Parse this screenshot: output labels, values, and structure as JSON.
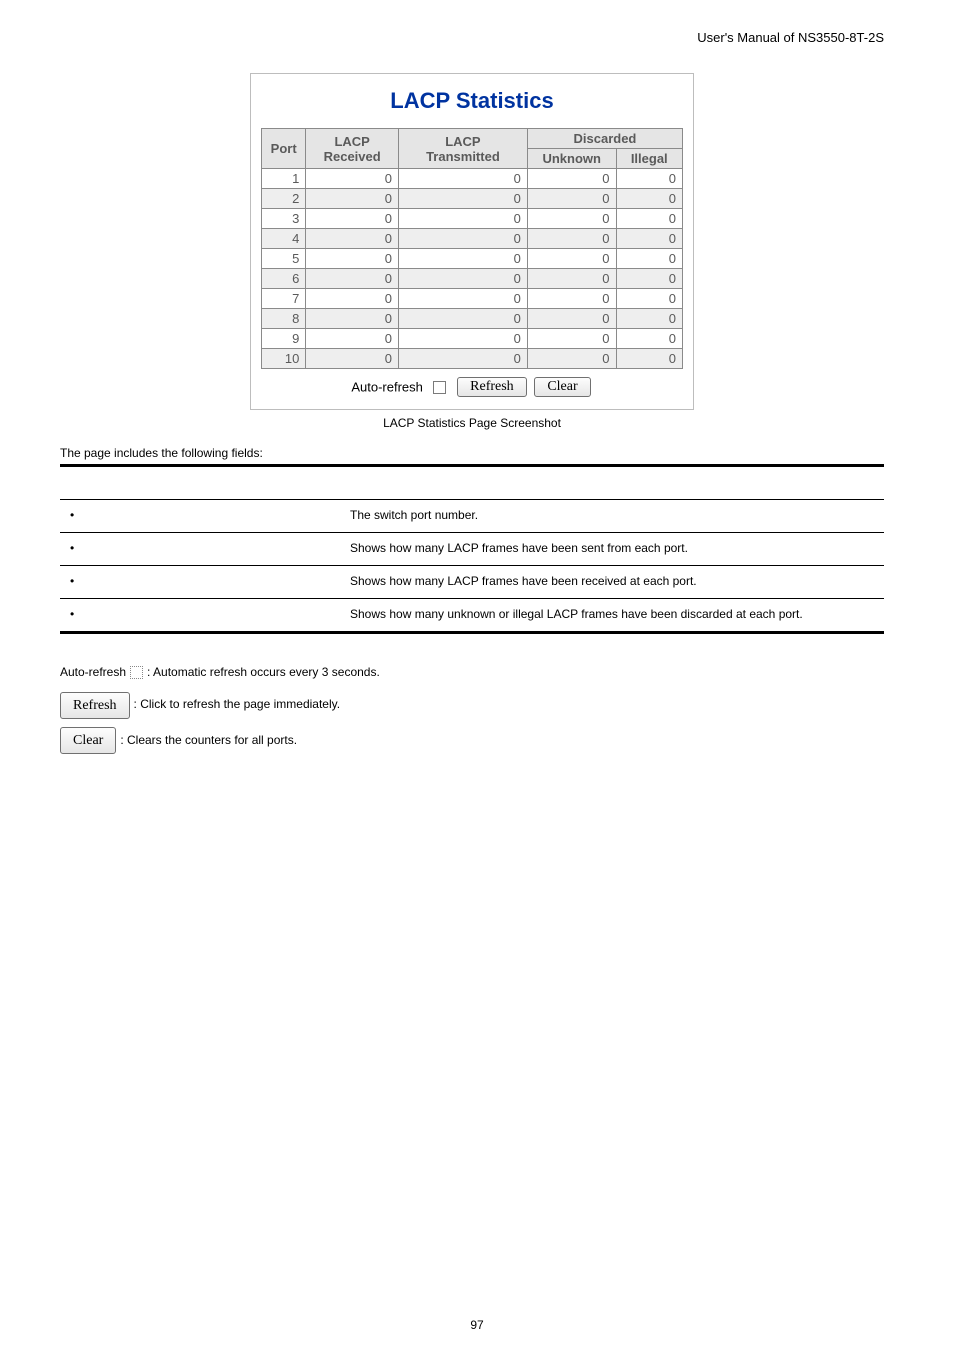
{
  "header": {
    "right": "User's Manual of NS3550-8T-2S"
  },
  "screenshot": {
    "title": "LACP Statistics",
    "columns": {
      "port": "Port",
      "received": "LACP\nReceived",
      "transmitted": "LACP\nTransmitted",
      "discarded": "Discarded",
      "unknown": "Unknown",
      "illegal": "Illegal"
    },
    "rows": [
      {
        "port": "1",
        "received": "0",
        "transmitted": "0",
        "unknown": "0",
        "illegal": "0"
      },
      {
        "port": "2",
        "received": "0",
        "transmitted": "0",
        "unknown": "0",
        "illegal": "0"
      },
      {
        "port": "3",
        "received": "0",
        "transmitted": "0",
        "unknown": "0",
        "illegal": "0"
      },
      {
        "port": "4",
        "received": "0",
        "transmitted": "0",
        "unknown": "0",
        "illegal": "0"
      },
      {
        "port": "5",
        "received": "0",
        "transmitted": "0",
        "unknown": "0",
        "illegal": "0"
      },
      {
        "port": "6",
        "received": "0",
        "transmitted": "0",
        "unknown": "0",
        "illegal": "0"
      },
      {
        "port": "7",
        "received": "0",
        "transmitted": "0",
        "unknown": "0",
        "illegal": "0"
      },
      {
        "port": "8",
        "received": "0",
        "transmitted": "0",
        "unknown": "0",
        "illegal": "0"
      },
      {
        "port": "9",
        "received": "0",
        "transmitted": "0",
        "unknown": "0",
        "illegal": "0"
      },
      {
        "port": "10",
        "received": "0",
        "transmitted": "0",
        "unknown": "0",
        "illegal": "0"
      }
    ],
    "controls": {
      "auto_refresh_label": "Auto-refresh",
      "refresh_btn": "Refresh",
      "clear_btn": "Clear"
    },
    "caption": "LACP Statistics Page Screenshot"
  },
  "fields": {
    "intro": "The page includes the following fields:",
    "items": [
      {
        "desc": "The switch port number."
      },
      {
        "desc": "Shows how many LACP frames have been sent from each port."
      },
      {
        "desc": "Shows how many LACP frames have been received at each port."
      },
      {
        "desc": "Shows how many unknown or illegal LACP frames have been discarded at each port."
      }
    ]
  },
  "notes": {
    "auto_refresh_prefix": "Auto-refresh",
    "auto_refresh_text": ": Automatic refresh occurs every 3 seconds.",
    "refresh_label": "Refresh",
    "refresh_text": ": Click to refresh the page immediately.",
    "clear_label": "Clear",
    "clear_text": ": Clears the counters for all ports."
  },
  "page_number": "97"
}
